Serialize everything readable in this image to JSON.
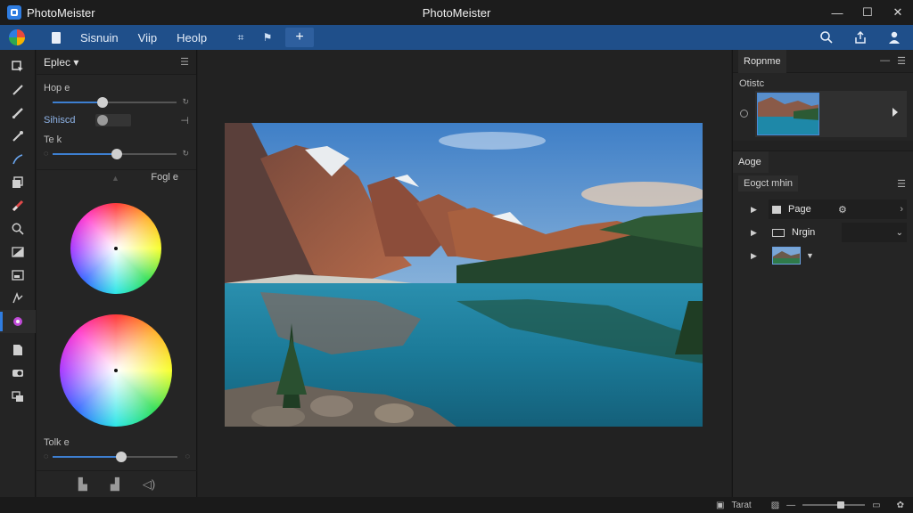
{
  "window": {
    "app_name": "PhotoMeister",
    "title": "PhotoMeister",
    "controls": [
      "—",
      "☐",
      "✕"
    ]
  },
  "menubar": {
    "items": [
      "Sisnuin",
      "Viip",
      "Heolp"
    ],
    "plus_label": "+"
  },
  "left_panel": {
    "tab_label": "Eplec",
    "control1_label": "Hop e",
    "control1_value": 0.4,
    "toggle_label": "Sihiscd",
    "control2_label": "Te k",
    "control2_value": 0.52,
    "wheel_label": "Fogl e",
    "control3_label": "Tolk e",
    "control3_value": 0.55
  },
  "right_panel": {
    "top_tab": "Ropnme",
    "sub_label": "Otistc",
    "section_tab": "Aoge",
    "section_row_label": "Eogct mhin",
    "layers": [
      {
        "name": "Page"
      },
      {
        "name": "Nrgin"
      }
    ]
  },
  "statusbar": {
    "label": "Tarat",
    "zoom_value": 0.55
  },
  "colors": {
    "accent": "#2f7de1",
    "menubar_bg": "#1f4f8a"
  }
}
